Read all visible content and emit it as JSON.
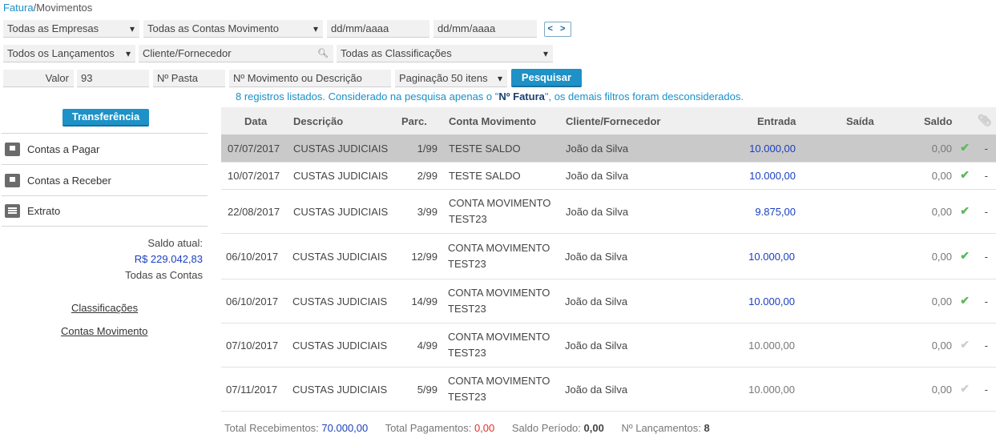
{
  "breadcrumb": {
    "link": "Fatura",
    "sep": "/",
    "current": "Movimentos"
  },
  "filters": {
    "empresas": "Todas as Empresas",
    "contas": "Todas as Contas Movimento",
    "date_from_placeholder": "dd/mm/aaaa",
    "date_to_placeholder": "dd/mm/aaaa",
    "nav_label": "< >",
    "lancamentos": "Todos os Lançamentos",
    "cliente_placeholder": "Cliente/Fornecedor",
    "classificacoes": "Todas as Classificações",
    "valor_label": "Valor",
    "valor_value": "93",
    "pasta_placeholder": "Nº Pasta",
    "movimento_placeholder": "Nº Movimento ou Descrição",
    "paginacao": "Paginação 50 itens",
    "pesquisar_label": "Pesquisar"
  },
  "info": {
    "before": "8 registros listados. Considerado na pesquisa apenas o \"",
    "bold": "Nº Fatura",
    "after": "\", os demais filtros foram desconsiderados."
  },
  "sidebar": {
    "transfer_label": "Transferência",
    "items": [
      {
        "label": "Contas a Pagar",
        "icon": "upload-icon"
      },
      {
        "label": "Contas a Receber",
        "icon": "download-icon"
      },
      {
        "label": "Extrato",
        "icon": "document-icon"
      }
    ],
    "saldo_label": "Saldo atual:",
    "saldo_value": "R$ 229.042,83",
    "saldo_scope": "Todas as Contas",
    "link_classificacoes": "Classificações",
    "link_contas_movimento": "Contas Movimento"
  },
  "table": {
    "headers": {
      "data": "Data",
      "descricao": "Descrição",
      "parc": "Parc.",
      "conta": "Conta Movimento",
      "cliente": "Cliente/Fornecedor",
      "entrada": "Entrada",
      "saida": "Saída",
      "saldo": "Saldo"
    },
    "rows": [
      {
        "data": "07/07/2017",
        "descricao": "CUSTAS JUDICIAIS",
        "parc": "1/99",
        "conta1": "TESTE SALDO",
        "conta2": "",
        "cliente": "João da Silva",
        "entrada": "10.000,00",
        "saldo": "0,00",
        "dash": "-"
      },
      {
        "data": "10/07/2017",
        "descricao": "CUSTAS JUDICIAIS",
        "parc": "2/99",
        "conta1": "TESTE SALDO",
        "conta2": "",
        "cliente": "João da Silva",
        "entrada": "10.000,00",
        "saldo": "0,00",
        "dash": "-"
      },
      {
        "data": "22/08/2017",
        "descricao": "CUSTAS JUDICIAIS",
        "parc": "3/99",
        "conta1": "CONTA MOVIMENTO",
        "conta2": "TEST23",
        "cliente": "João da Silva",
        "entrada": "9.875,00",
        "saldo": "0,00",
        "dash": "-"
      },
      {
        "data": "06/10/2017",
        "descricao": "CUSTAS JUDICIAIS",
        "parc": "12/99",
        "conta1": "CONTA MOVIMENTO",
        "conta2": "TEST23",
        "cliente": "João da Silva",
        "entrada": "10.000,00",
        "saldo": "0,00",
        "dash": "-"
      },
      {
        "data": "06/10/2017",
        "descricao": "CUSTAS JUDICIAIS",
        "parc": "14/99",
        "conta1": "CONTA MOVIMENTO",
        "conta2": "TEST23",
        "cliente": "João da Silva",
        "entrada": "10.000,00",
        "saldo": "0,00",
        "dash": "-"
      },
      {
        "data": "07/10/2017",
        "descricao": "CUSTAS JUDICIAIS",
        "parc": "4/99",
        "conta1": "CONTA MOVIMENTO",
        "conta2": "TEST23",
        "cliente": "João da Silva",
        "entrada": "10.000,00",
        "saldo": "0,00",
        "dash": "-"
      },
      {
        "data": "07/11/2017",
        "descricao": "CUSTAS JUDICIAIS",
        "parc": "5/99",
        "conta1": "CONTA MOVIMENTO",
        "conta2": "TEST23",
        "cliente": "João da Silva",
        "entrada": "10.000,00",
        "saldo": "0,00",
        "dash": "-"
      }
    ]
  },
  "footer": {
    "receb_label": "Total Recebimentos:",
    "receb_value": "70.000,00",
    "pag_label": "Total Pagamentos:",
    "pag_value": "0,00",
    "saldo_label": "Saldo Período:",
    "saldo_value": "0,00",
    "lanc_label": "Nº Lançamentos:",
    "lanc_value": "8"
  }
}
